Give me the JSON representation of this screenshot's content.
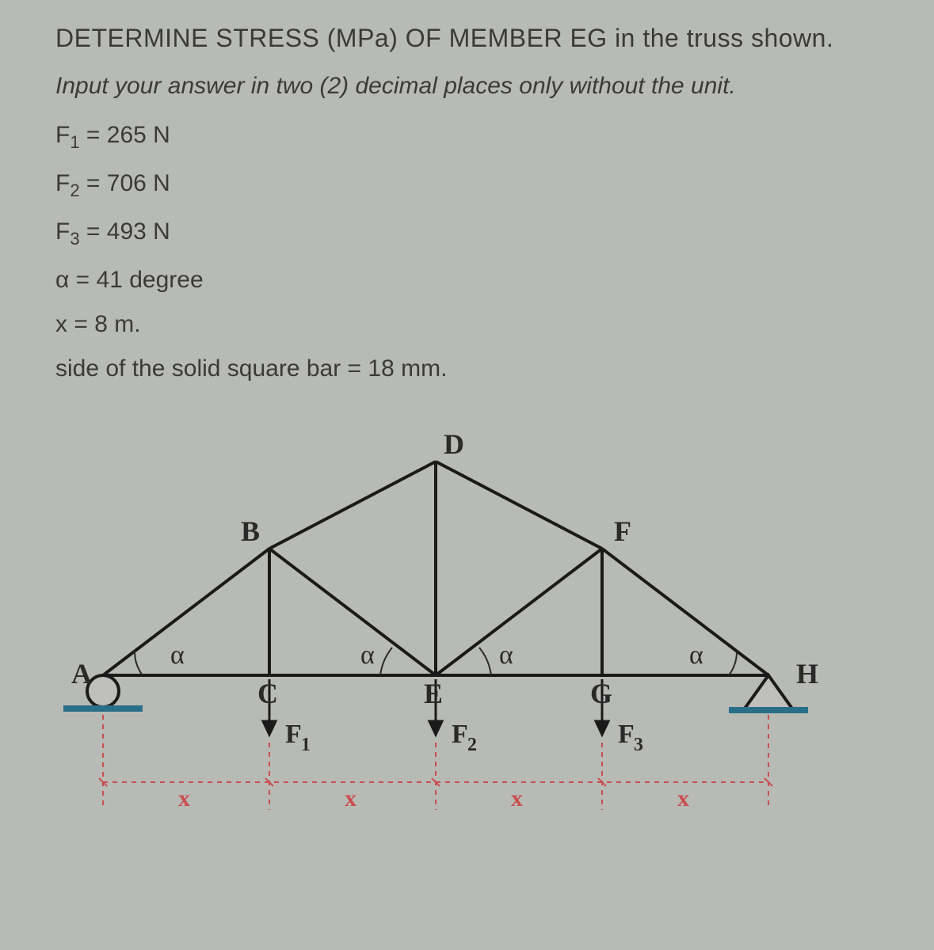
{
  "title": "DETERMINE STRESS (MPa) OF MEMBER EG in the truss shown.",
  "instruction": "Input your answer in two (2) decimal places only without the unit.",
  "params": {
    "f1_label": "F",
    "f1_sub": "1",
    "f1_value": " = 265 N",
    "f2_label": "F",
    "f2_sub": "2",
    "f2_value": " = 706 N",
    "f3_label": "F",
    "f3_sub": "3",
    "f3_value": " = 493 N",
    "alpha": "α = 41 degree",
    "x": "x = 8 m.",
    "bar": "side of the solid square bar = 18 mm."
  },
  "diagram": {
    "nodes": {
      "A": "A",
      "B": "B",
      "C": "C",
      "D": "D",
      "E": "E",
      "F": "F",
      "G": "G",
      "H": "H"
    },
    "angle": "α",
    "forces": {
      "f1": "F",
      "f1s": "1",
      "f2": "F",
      "f2s": "2",
      "f3": "F",
      "f3s": "3"
    },
    "dim": "x"
  }
}
